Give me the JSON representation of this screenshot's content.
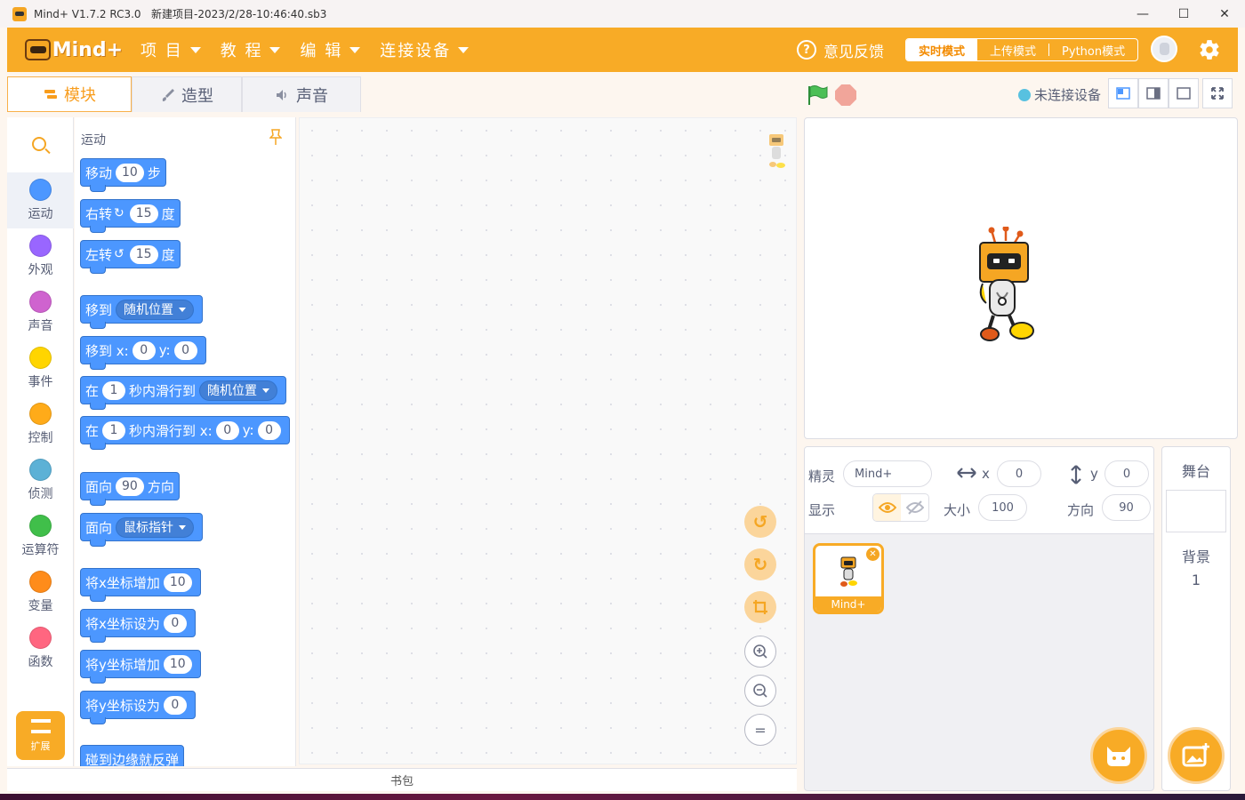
{
  "window": {
    "title": "Mind+ V1.7.2 RC3.0   新建项目-2023/2/28-10:46:40.sb3",
    "controls": {
      "minimize": "—",
      "maximize": "☐",
      "close": "✕"
    }
  },
  "menubar": {
    "logo_text": "Mind+",
    "items": [
      {
        "label": "项 目"
      },
      {
        "label": "教 程"
      },
      {
        "label": "编 辑"
      },
      {
        "label": "连接设备"
      }
    ],
    "feedback": "意见反馈",
    "modes": [
      {
        "label": "实时模式"
      },
      {
        "label": "上传模式"
      },
      {
        "label": "Python模式"
      }
    ]
  },
  "tabs": [
    {
      "label": "模块"
    },
    {
      "label": "造型"
    },
    {
      "label": "声音"
    }
  ],
  "connection": {
    "status": "未连接设备",
    "dot_color": "#58c1e0"
  },
  "categories": [
    {
      "label": "运动",
      "color": "#4c97ff"
    },
    {
      "label": "外观",
      "color": "#9966ff"
    },
    {
      "label": "声音",
      "color": "#cf63cf"
    },
    {
      "label": "事件",
      "color": "#ffd500"
    },
    {
      "label": "控制",
      "color": "#ffab19"
    },
    {
      "label": "侦测",
      "color": "#5cb1d6"
    },
    {
      "label": "运算符",
      "color": "#40bf4a"
    },
    {
      "label": "变量",
      "color": "#ff8c1a"
    },
    {
      "label": "函数",
      "color": "#ff6680"
    }
  ],
  "extension_label": "扩展",
  "palette": {
    "title": "运动",
    "blocks": {
      "move": {
        "a": "移动",
        "v": "10",
        "b": "步"
      },
      "turn_right": {
        "a": "右转",
        "v": "15",
        "b": "度"
      },
      "turn_left": {
        "a": "左转",
        "v": "15",
        "b": "度"
      },
      "goto": {
        "a": "移到",
        "dd": "随机位置"
      },
      "goto_xy": {
        "a": "移到 x:",
        "x": "0",
        "b": "y:",
        "y": "0"
      },
      "glide": {
        "a": "在",
        "v": "1",
        "b": "秒内滑行到",
        "dd": "随机位置"
      },
      "glide_xy": {
        "a": "在",
        "v": "1",
        "b": "秒内滑行到 x:",
        "x": "0",
        "c": "y:",
        "y": "0"
      },
      "point_dir": {
        "a": "面向",
        "v": "90",
        "b": "方向"
      },
      "point_towards": {
        "a": "面向",
        "dd": "鼠标指针"
      },
      "change_x": {
        "a": "将x坐标增加",
        "v": "10"
      },
      "set_x": {
        "a": "将x坐标设为",
        "v": "0"
      },
      "change_y": {
        "a": "将y坐标增加",
        "v": "10"
      },
      "set_y": {
        "a": "将y坐标设为",
        "v": "0"
      },
      "bounce": {
        "a": "碰到边缘就反弹"
      }
    }
  },
  "backpack_label": "书包",
  "workspace_buttons": {
    "undo": "↺",
    "redo": "↻",
    "zoom_in": "+",
    "zoom_out": "−",
    "reset": "="
  },
  "sprite_info": {
    "sprite_label": "精灵",
    "sprite_name": "Mind+",
    "x_label": "x",
    "x_value": "0",
    "y_label": "y",
    "y_value": "0",
    "show_label": "显示",
    "size_label": "大小",
    "size_value": "100",
    "direction_label": "方向",
    "direction_value": "90"
  },
  "sprite_list": [
    {
      "name": "Mind+"
    }
  ],
  "stage_panel": {
    "title": "舞台",
    "backdrop_label": "背景",
    "backdrop_count": "1"
  },
  "colors": {
    "brand": "#f8ab26",
    "motion": "#4c97ff"
  }
}
